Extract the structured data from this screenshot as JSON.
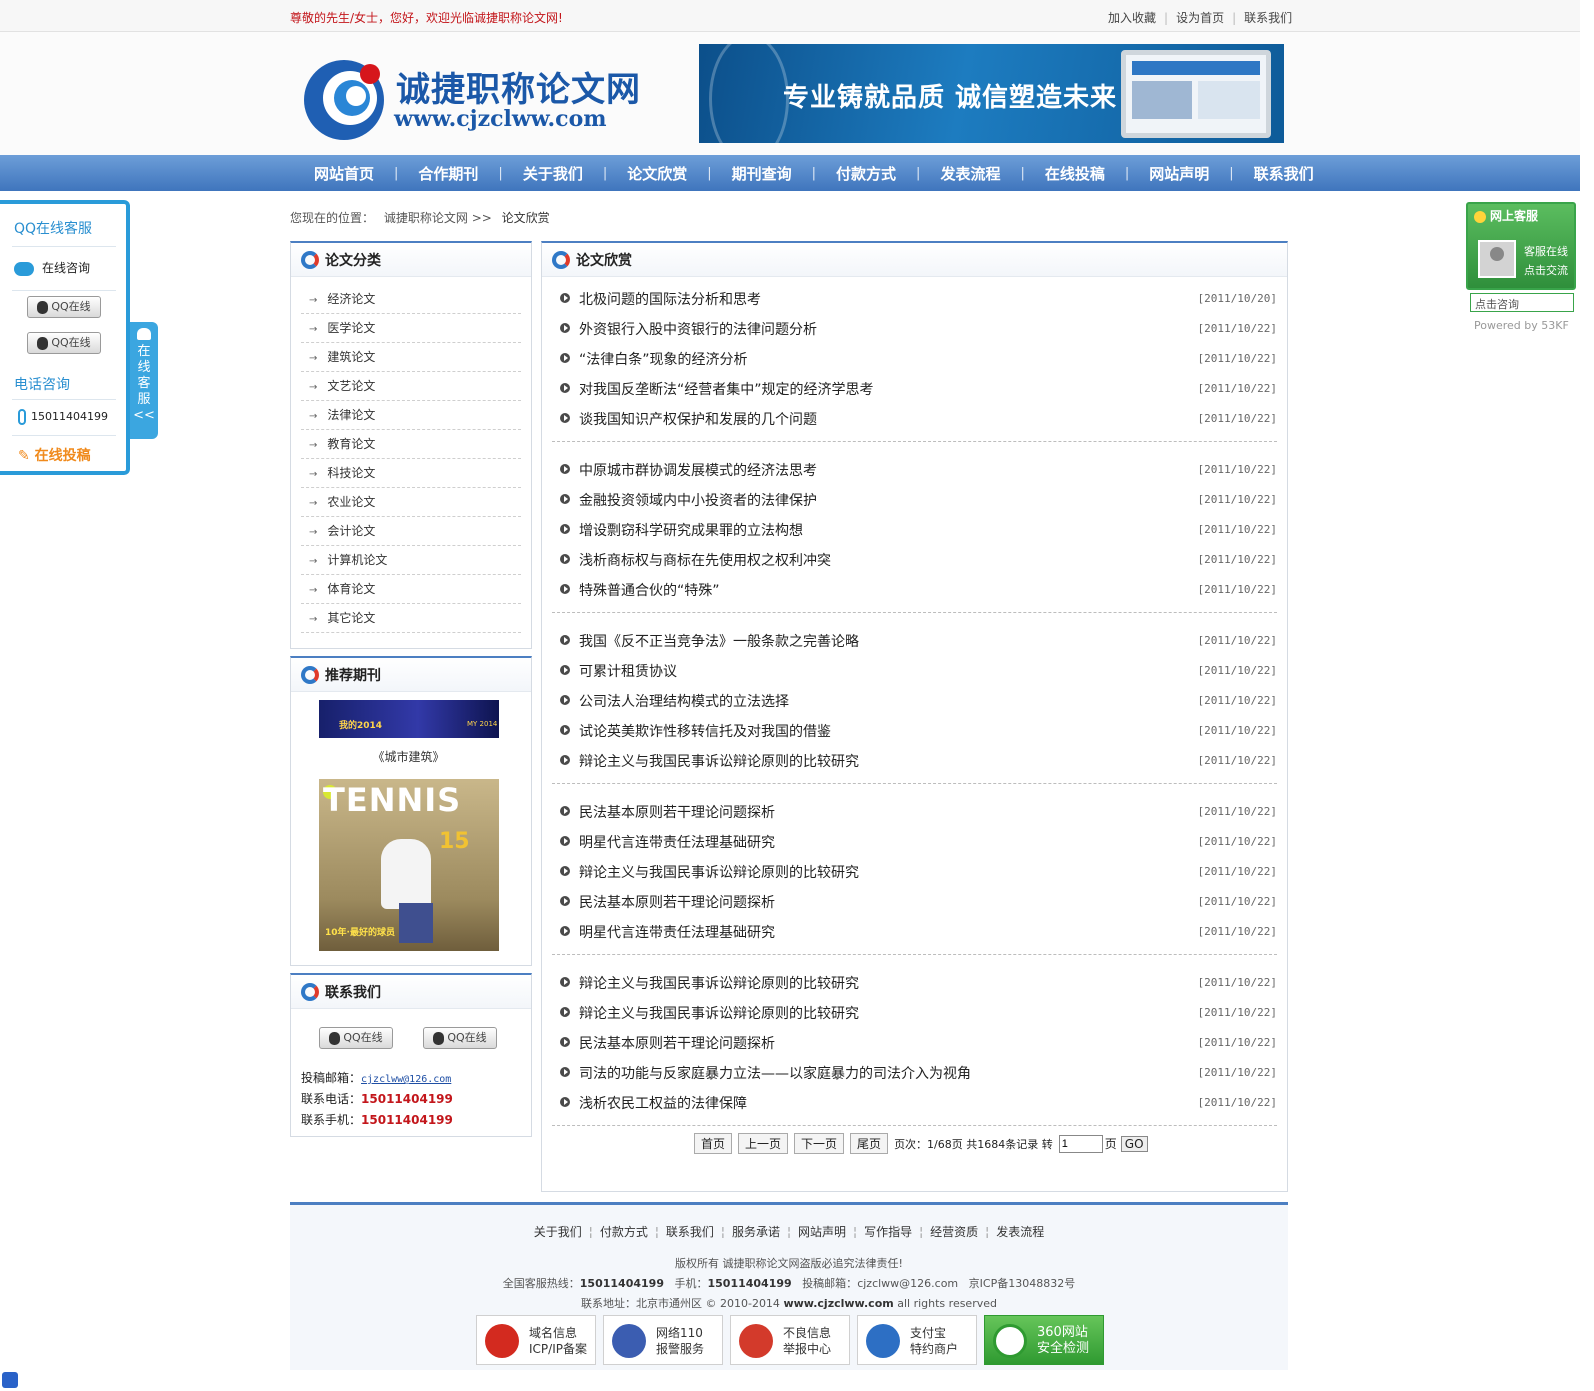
{
  "topbar": {
    "welcome": "尊敬的先生/女士，您好，欢迎光临诚捷职称论文网!",
    "links": [
      "加入收藏",
      "设为首页",
      "联系我们"
    ]
  },
  "header": {
    "logo_cn": "诚捷职称论文网",
    "logo_url": "www.cjzclww.com",
    "banner_text": "专业铸就品质  诚信塑造未来"
  },
  "nav": [
    "网站首页",
    "合作期刊",
    "关于我们",
    "论文欣赏",
    "期刊查询",
    "付款方式",
    "发表流程",
    "在线投稿",
    "网站声明",
    "联系我们"
  ],
  "left_float": {
    "title": "QQ在线客服",
    "consult": "在线咨询",
    "qq_label": "QQ在线",
    "phone_title": "电话咨询",
    "phone": "15011404199",
    "submit": "在线投稿",
    "tab": [
      "在",
      "线",
      "客",
      "服",
      "<<"
    ]
  },
  "right_float": {
    "title": "网上客服",
    "line1": "客服在线",
    "line2": "点击交流",
    "input_value": "点击咨询",
    "powered": "Powered by 53KF"
  },
  "breadcrumb": {
    "prefix": "您现在的位置：",
    "home": "诚捷职称论文网",
    "sep": ">>",
    "current": "论文欣赏"
  },
  "categories": {
    "title": "论文分类",
    "items": [
      "经济论文",
      "医学论文",
      "建筑论文",
      "文艺论文",
      "法律论文",
      "教育论文",
      "科技论文",
      "农业论文",
      "会计论文",
      "计算机论文",
      "体育论文",
      "其它论文"
    ]
  },
  "journals": {
    "title": "推荐期刊",
    "caption1": "《城市建筑》",
    "img1_text1": "我的2014",
    "img1_text2": "MY 2014",
    "img2_title": "TENNIS",
    "img2_num": "15",
    "img2_bottom": "10年·最好的球员"
  },
  "contact": {
    "title": "联系我们",
    "qq_label": "QQ在线",
    "email_label": "投稿邮箱：",
    "email": "cjzclww@126.com",
    "tel_label": "联系电话：",
    "tel": "15011404199",
    "mobile_label": "联系手机：",
    "mobile": "15011404199"
  },
  "main": {
    "title": "论文欣赏",
    "groups": [
      [
        {
          "title": "北极问题的国际法分析和思考",
          "date": "[2011/10/20]"
        },
        {
          "title": "外资银行入股中资银行的法律问题分析",
          "date": "[2011/10/22]"
        },
        {
          "title": "“法律白条”现象的经济分析",
          "date": "[2011/10/22]"
        },
        {
          "title": "对我国反垄断法“经营者集中”规定的经济学思考",
          "date": "[2011/10/22]"
        },
        {
          "title": "谈我国知识产权保护和发展的几个问题",
          "date": "[2011/10/22]"
        }
      ],
      [
        {
          "title": "中原城市群协调发展模式的经济法思考",
          "date": "[2011/10/22]"
        },
        {
          "title": "金融投资领域内中小投资者的法律保护",
          "date": "[2011/10/22]"
        },
        {
          "title": "增设剽窃科学研究成果罪的立法构想",
          "date": "[2011/10/22]"
        },
        {
          "title": "浅析商标权与商标在先使用权之权利冲突",
          "date": "[2011/10/22]"
        },
        {
          "title": "特殊普通合伙的“特殊”",
          "date": "[2011/10/22]"
        }
      ],
      [
        {
          "title": "我国《反不正当竞争法》一般条款之完善论略",
          "date": "[2011/10/22]"
        },
        {
          "title": "可累计租赁协议",
          "date": "[2011/10/22]"
        },
        {
          "title": "公司法人治理结构模式的立法选择",
          "date": "[2011/10/22]"
        },
        {
          "title": "试论英美欺诈性移转信托及对我国的借鉴",
          "date": "[2011/10/22]"
        },
        {
          "title": "辩论主义与我国民事诉讼辩论原则的比较研究",
          "date": "[2011/10/22]"
        }
      ],
      [
        {
          "title": "民法基本原则若干理论问题探析",
          "date": "[2011/10/22]"
        },
        {
          "title": "明星代言连带责任法理基础研究",
          "date": "[2011/10/22]"
        },
        {
          "title": "辩论主义与我国民事诉讼辩论原则的比较研究",
          "date": "[2011/10/22]"
        },
        {
          "title": "民法基本原则若干理论问题探析",
          "date": "[2011/10/22]"
        },
        {
          "title": "明星代言连带责任法理基础研究",
          "date": "[2011/10/22]"
        }
      ],
      [
        {
          "title": "辩论主义与我国民事诉讼辩论原则的比较研究",
          "date": "[2011/10/22]"
        },
        {
          "title": "辩论主义与我国民事诉讼辩论原则的比较研究",
          "date": "[2011/10/22]"
        },
        {
          "title": "民法基本原则若干理论问题探析",
          "date": "[2011/10/22]"
        },
        {
          "title": "司法的功能与反家庭暴力立法——以家庭暴力的司法介入为视角",
          "date": "[2011/10/22]"
        },
        {
          "title": "浅析农民工权益的法律保障",
          "date": "[2011/10/22]"
        }
      ]
    ],
    "pager": {
      "first": "首页",
      "prev": "上一页",
      "next": "下一页",
      "last": "尾页",
      "info": "页次：1/68页 共1684条记录 转",
      "input": "1",
      "page_unit": "页",
      "go": "GO"
    }
  },
  "footer": {
    "links": [
      "关于我们",
      "付款方式",
      "联系我们",
      "服务承诺",
      "网站声明",
      "写作指导",
      "经营资质",
      "发表流程"
    ],
    "copyright": "版权所有 诚捷职称论文网盗版必追究法律责任!",
    "hotline_label": "全国客服热线：",
    "hotline": "15011404199",
    "mobile_label": "手机：",
    "mobile": "15011404199",
    "email_label": "投稿邮箱：",
    "email": "cjzclww@126.com",
    "icp": "京ICP备13048832号",
    "address": "联系地址：北京市通州区 © 2010-2014",
    "site": "www.cjzclww.com",
    "rights": "all rights reserved",
    "badges": [
      {
        "l1": "域名信息",
        "l2": "ICP/IP备案",
        "color": "#d32a1f"
      },
      {
        "l1": "网络110",
        "l2": "报警服务",
        "color": "#3b5db1"
      },
      {
        "l1": "不良信息",
        "l2": "举报中心",
        "color": "#d33a2b"
      },
      {
        "l1": "支付宝",
        "l2": "特约商户",
        "color": "#2d6fc4"
      },
      {
        "l1": "360网站",
        "l2": "安全检测",
        "color": "#ffffff"
      }
    ]
  }
}
